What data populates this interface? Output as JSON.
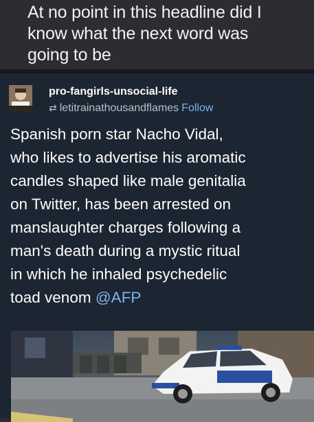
{
  "caption": {
    "line1": "At no point in this headline did I",
    "line2": "know what the next word was",
    "line3": "going to be"
  },
  "post": {
    "blog_name": "pro-fangirls-unsocial-life",
    "reblogged_from": "letitrainathousandflames",
    "follow_label": "Follow",
    "reblog_icon": "reblog-icon",
    "body_lines": [
      "Spanish porn star Nacho Vidal,",
      "who likes to advertise his aromatic",
      "candles shaped like male genitalia",
      "on Twitter, has been arrested on",
      "manslaughter charges following a",
      "man's death during a mystic ritual",
      "in which he inhaled psychedelic",
      "toad venom"
    ],
    "mention": "@AFP"
  },
  "colors": {
    "caption_bg": "#2b2d31",
    "post_bg": "#1c2632",
    "link": "#7fb2e6",
    "text": "#ffffff"
  }
}
